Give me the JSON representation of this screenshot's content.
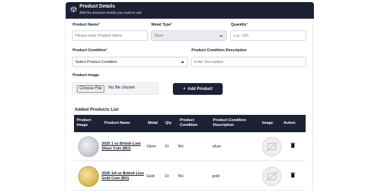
{
  "header": {
    "title": "Product Details",
    "subtitle": "Add the precious metals you want to sell"
  },
  "form": {
    "product_name_label": "Product Name",
    "product_name_placeholder": "Please enter Product Name",
    "metal_type_label": "Metal Type",
    "metal_type_value": "Silver",
    "quantity_label": "Quantity",
    "quantity_placeholder": "e.g.: 100",
    "condition_label": "Product Condition",
    "condition_value": "Select Product Condition",
    "condition_desc_label": "Product Condition Description",
    "condition_desc_placeholder": "Enter Description",
    "image_label": "Product Image",
    "choose_file_label": "Choose File",
    "no_file_text": "No file chosen",
    "required_mark": "*",
    "add_button_label": "Add Product",
    "add_button_icon": "+"
  },
  "table": {
    "title": "Added Products List",
    "columns": {
      "image": "Product Image",
      "name": "Product Name",
      "metal": "Metal",
      "qty": "Qty",
      "condition": "Product Condition",
      "description": "Product Condition Description",
      "img": "Image",
      "action": "Action"
    },
    "rows": [
      {
        "name": "2025 1 oz British Lion Silver Coin (BU)",
        "metal": "Silver",
        "qty": "10",
        "condition": "BU",
        "description": "silver",
        "coin_color": "#c9ccd1"
      },
      {
        "name": "2025 1/4 oz British Lion Gold Coin (BU)",
        "metal": "Gold",
        "qty": "10",
        "condition": "BU",
        "description": "gold",
        "coin_color": "#d9bc5a"
      }
    ]
  },
  "colors": {
    "dark": "#1b2234",
    "required": "#dc2626"
  }
}
